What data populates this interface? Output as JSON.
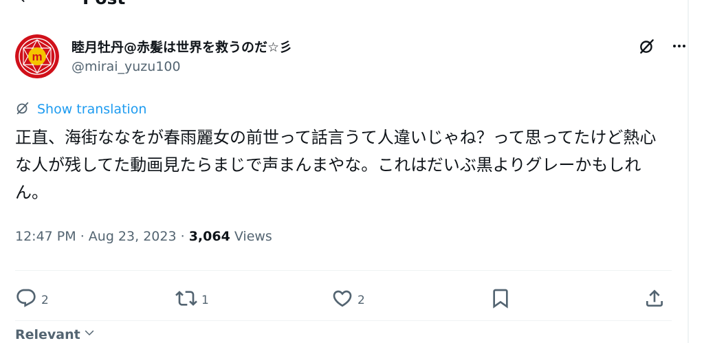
{
  "topbar": {
    "title": "Post"
  },
  "author": {
    "name": "睦月牡丹@赤髪は世界を救うのだ☆彡",
    "handle": "@mirai_yuzu100",
    "avatar_letter": "m"
  },
  "translation": {
    "label": "Show translation"
  },
  "post": {
    "text": "正直、海街ななをが春雨麗女の前世って話言うて人違いじゃね？って思ってたけど熱心な人が残してた動画見たらまじで声まんまやな。これはだいぶ黒よりグレーかもしれん。"
  },
  "meta": {
    "time": "12:47 PM",
    "date": "Aug 23, 2023",
    "views_count": "3,064",
    "views_label": "Views",
    "separator": "·"
  },
  "actions": {
    "replies": "2",
    "reposts": "1",
    "likes": "2"
  },
  "replies_sort": {
    "label": "Relevant"
  },
  "colors": {
    "accent": "#1d9bf0",
    "text": "#0f1419",
    "secondary": "#536471",
    "avatar_bg": "#d0101a"
  },
  "icons": {
    "back": "arrow-left-icon",
    "grok": "grok-icon",
    "more": "more-icon",
    "translate": "translate-icon",
    "reply": "reply-icon",
    "repost": "repost-icon",
    "like": "like-icon",
    "bookmark": "bookmark-icon",
    "share": "share-icon",
    "chevron": "chevron-down-icon"
  }
}
